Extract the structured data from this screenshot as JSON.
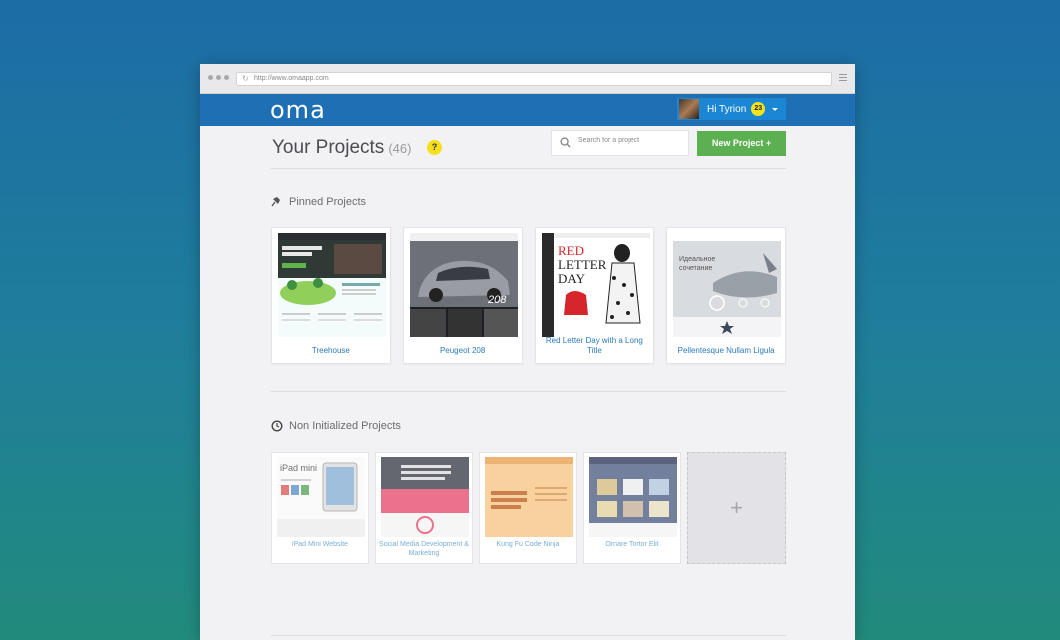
{
  "browser": {
    "url": "http://www.omaapp.com"
  },
  "app": {
    "logo": "oma",
    "user": {
      "greeting": "Hi Tyrion",
      "notifications": "23"
    }
  },
  "projects": {
    "title": "Your Projects",
    "count": "(46)",
    "help": "?",
    "search_placeholder": "Search for a project",
    "new_button": "New Project  +"
  },
  "pinned": {
    "heading": "Pinned Projects",
    "items": [
      {
        "label": "Treehouse"
      },
      {
        "label": "Peugeot 208"
      },
      {
        "label": "Red Letter Day with a Long Title"
      },
      {
        "label": "Pellentesque Nullam Ligula"
      }
    ]
  },
  "noninit": {
    "heading": "Non Initialized Projects",
    "items": [
      {
        "label": "iPad Mini Website"
      },
      {
        "label": "Social Media Development & Marketing"
      },
      {
        "label": "Kung  Fu Code Ninja"
      },
      {
        "label": "Ornare Tortor Elit"
      }
    ],
    "add": "+"
  },
  "colors": {
    "appbar": "#1f6fb5",
    "accent_green": "#5cb052",
    "badge_yellow": "#f4e31b"
  }
}
